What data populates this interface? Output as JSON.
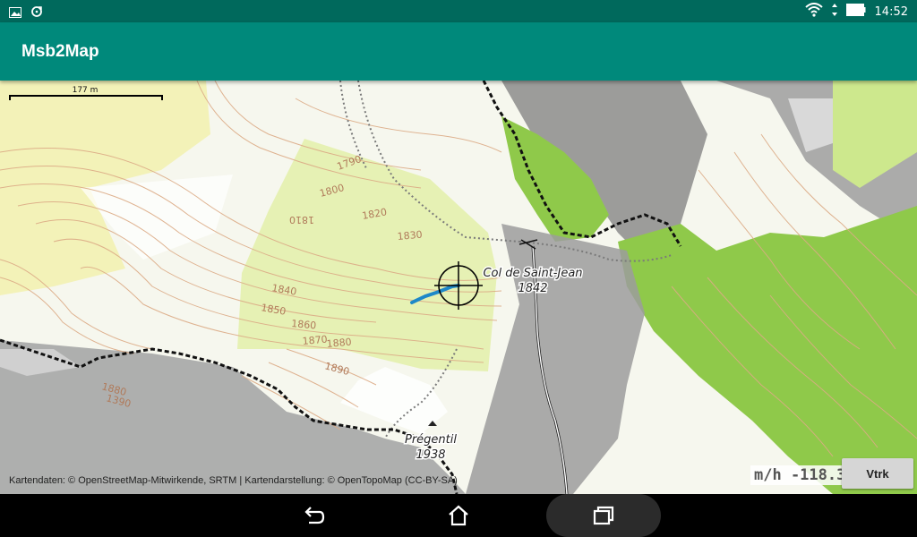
{
  "status_bar": {
    "time": "14:52",
    "icons_left": [
      "image-icon",
      "sync-icon"
    ],
    "icons_right": [
      "wifi-icon",
      "signal-icon",
      "battery-icon"
    ]
  },
  "app_bar": {
    "title": "Msb2Map"
  },
  "map": {
    "scale_label": "177 m",
    "attribution": "Kartendaten: © OpenStreetMap-Mitwirkende, SRTM | Kartendarstellung: © OpenTopoMap (CC-BY-SA)",
    "places": [
      {
        "name": "Col de Saint-Jean",
        "elevation": "1842"
      },
      {
        "name": "Prégentil",
        "elevation": "1938"
      }
    ],
    "contour_labels": [
      "1790",
      "1800",
      "1810",
      "1820",
      "1830",
      "1840",
      "1850",
      "1860",
      "1870",
      "1880",
      "1890",
      "1880",
      "1390"
    ],
    "colors": {
      "forest": "#8dc63f",
      "meadow": "#e8f2b8",
      "rock": "#8c8c8c",
      "contour": "#d9a27a",
      "track": "#1e88c8"
    }
  },
  "speed_readout": "m/h -118.3",
  "vtrk_button": "Vtrk",
  "nav_bar": {
    "buttons": [
      "back-icon",
      "home-icon",
      "recents-icon"
    ]
  }
}
